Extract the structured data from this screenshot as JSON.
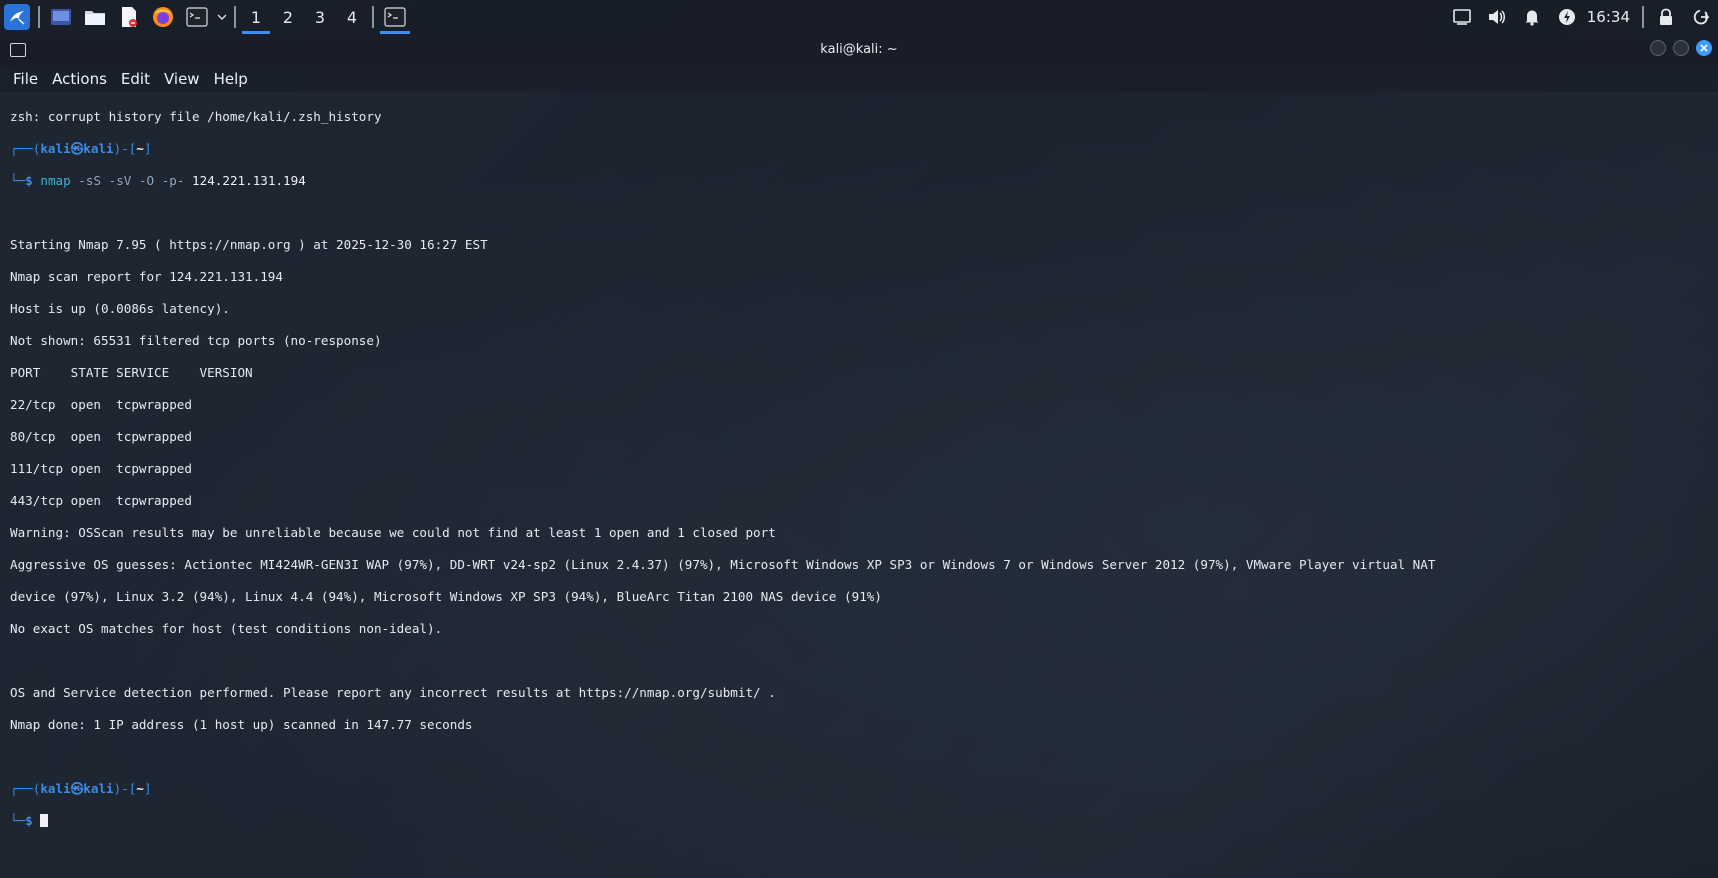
{
  "taskbar": {
    "workspaces": [
      "1",
      "2",
      "3",
      "4"
    ],
    "clock": "16:34",
    "icons": {
      "menu": "kali-dragon-icon",
      "desktop": "show-desktop-icon",
      "files": "file-manager-icon",
      "editor": "text-editor-icon",
      "browser": "firefox-icon",
      "terminal": "terminal-icon",
      "dropdown": "chevron-down-icon",
      "display": "display-icon",
      "volume": "volume-icon",
      "notifications": "bell-icon",
      "power": "power-manager-icon",
      "lock": "lock-icon",
      "logout": "logout-icon"
    },
    "accent": "#3d8ef0"
  },
  "window": {
    "title": "kali@kali: ~",
    "menu": [
      "File",
      "Actions",
      "Edit",
      "View",
      "Help"
    ]
  },
  "terminal": {
    "prompt": {
      "user": "kali",
      "sep": "㉿",
      "host": "kali",
      "dir": "~",
      "dollar": "$"
    },
    "command": {
      "name": "nmap",
      "args": "-sS -sV -O -p-",
      "target": "124.221.131.194"
    },
    "lines": {
      "l0": "zsh: corrupt history file /home/kali/.zsh_history",
      "l3": "Starting Nmap 7.95 ( https://nmap.org ) at 2025-12-30 16:27 EST",
      "l4": "Nmap scan report for 124.221.131.194",
      "l5": "Host is up (0.0086s latency).",
      "l6": "Not shown: 65531 filtered tcp ports (no-response)",
      "l7": "PORT    STATE SERVICE    VERSION",
      "l8": "22/tcp  open  tcpwrapped",
      "l9": "80/tcp  open  tcpwrapped",
      "l10": "111/tcp open  tcpwrapped",
      "l11": "443/tcp open  tcpwrapped",
      "l12": "Warning: OSScan results may be unreliable because we could not find at least 1 open and 1 closed port",
      "l13": "Aggressive OS guesses: Actiontec MI424WR-GEN3I WAP (97%), DD-WRT v24-sp2 (Linux 2.4.37) (97%), Microsoft Windows XP SP3 or Windows 7 or Windows Server 2012 (97%), VMware Player virtual NAT",
      "l14": "device (97%), Linux 3.2 (94%), Linux 4.4 (94%), Microsoft Windows XP SP3 (94%), BlueArc Titan 2100 NAS device (91%)",
      "l15": "No exact OS matches for host (test conditions non-ideal).",
      "l17": "OS and Service detection performed. Please report any incorrect results at https://nmap.org/submit/ .",
      "l18": "Nmap done: 1 IP address (1 host up) scanned in 147.77 seconds"
    },
    "colors": {
      "prompt": "#3c8ce6",
      "text": "#e6e9ee"
    }
  }
}
